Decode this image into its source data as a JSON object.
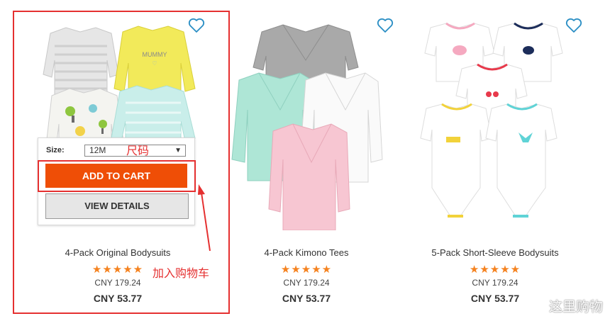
{
  "products": [
    {
      "name": "4-Pack Original Bodysuits",
      "rating": 5,
      "stars": "★★★★★",
      "original_price": "CNY 179.24",
      "sale_price": "CNY 53.77"
    },
    {
      "name": "4-Pack Kimono Tees",
      "rating": 5,
      "stars": "★★★★★",
      "original_price": "CNY 179.24",
      "sale_price": "CNY 53.77"
    },
    {
      "name": "5-Pack Short-Sleeve Bodysuits",
      "rating": 5,
      "stars": "★★★★★",
      "original_price": "CNY 179.24",
      "sale_price": "CNY 53.77"
    }
  ],
  "quick_add": {
    "size_label": "Size:",
    "size_value": "12M",
    "add_to_cart": "ADD TO CART",
    "view_details": "VIEW DETAILS"
  },
  "annotations": {
    "size_note": "尺码",
    "cart_note": "加入购物车"
  },
  "watermark": "这里购物",
  "colors": {
    "accent": "#ef4e06",
    "annotation": "#e53030",
    "heart": "#2a8ec4",
    "stars": "#f5821f"
  }
}
